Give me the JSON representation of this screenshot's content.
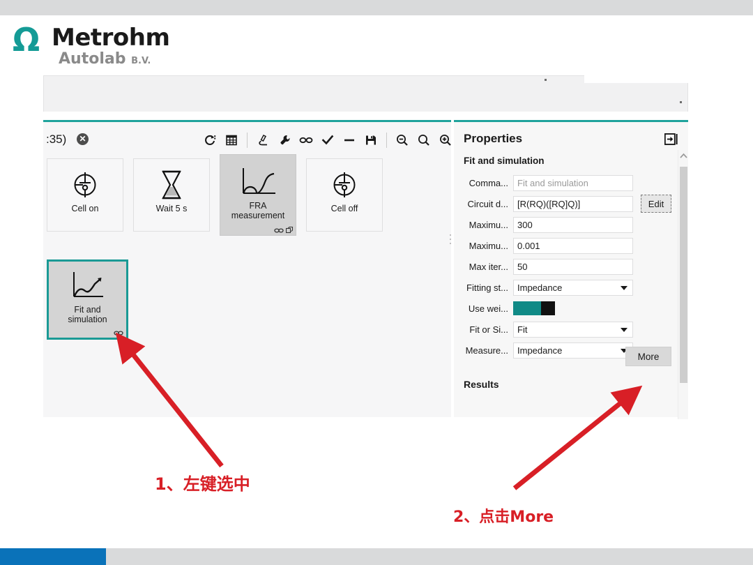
{
  "brand": {
    "omega": "Ω",
    "name": "Metrohm",
    "sub": "Autolab",
    "suffix": "B.V."
  },
  "app": {
    "tab": {
      "title": ":35)",
      "close_icon": "close-circle-icon"
    },
    "toolbar": {
      "icons": [
        "refresh-icon",
        "table-grid-icon",
        "microscope-icon",
        "wrench-icon",
        "link-icon",
        "checkmark-icon",
        "minus-icon",
        "save-floppy-icon",
        "zoom-out-icon",
        "zoom-reset-icon",
        "zoom-in-icon"
      ]
    },
    "cards": [
      {
        "label": "Cell on",
        "icon": "cell-on-icon",
        "state": "normal",
        "badges": []
      },
      {
        "label": "Wait 5 s",
        "icon": "hourglass-icon",
        "state": "normal",
        "badges": []
      },
      {
        "label": "FRA\nmeasurement",
        "icon": "fra-plot-icon",
        "state": "highlighted",
        "badges": [
          "link-icon",
          "expand-icon"
        ]
      },
      {
        "label": "Cell off",
        "icon": "cell-off-icon",
        "state": "normal",
        "badges": []
      },
      {
        "label": "Fit and\nsimulation",
        "icon": "fit-plot-icon",
        "state": "selected",
        "badges": [
          "link-icon"
        ]
      }
    ]
  },
  "properties": {
    "title": "Properties",
    "collapse_icon": "collapse-panel-icon",
    "section": "Fit and simulation",
    "rows": [
      {
        "label": "Comma...",
        "value": "",
        "placeholder": "Fit and simulation",
        "type": "text",
        "button": null
      },
      {
        "label": "Circuit d...",
        "value": "[R(RQ)([RQ]Q)]",
        "placeholder": "",
        "type": "text",
        "button": "Edit"
      },
      {
        "label": "Maximu...",
        "value": "300",
        "placeholder": "",
        "type": "text",
        "button": null
      },
      {
        "label": "Maximu...",
        "value": "0.001",
        "placeholder": "",
        "type": "text",
        "button": null
      },
      {
        "label": "Max iter...",
        "value": "50",
        "placeholder": "",
        "type": "text",
        "button": null
      },
      {
        "label": "Fitting st...",
        "value": "Impedance",
        "placeholder": "",
        "type": "select",
        "button": null
      },
      {
        "label": "Use wei...",
        "value": "on",
        "placeholder": "",
        "type": "toggle",
        "button": null
      },
      {
        "label": "Fit or Si...",
        "value": "Fit",
        "placeholder": "",
        "type": "select",
        "button": null
      },
      {
        "label": "Measure...",
        "value": "Impedance",
        "placeholder": "",
        "type": "select",
        "button": null
      }
    ],
    "more_label": "More",
    "results_label": "Results",
    "scroll_up_icon": "chevron-up-icon"
  },
  "annotations": [
    {
      "id": "1",
      "text": "1、左键选中"
    },
    {
      "id": "2",
      "text": "2、点击More"
    }
  ],
  "colors": {
    "accent_teal": "#1fa39c",
    "selection_teal": "#1a9a95",
    "annotation_red": "#d81f26",
    "bottom_blue": "#0a72b9",
    "toggle_on": "#108a86"
  }
}
